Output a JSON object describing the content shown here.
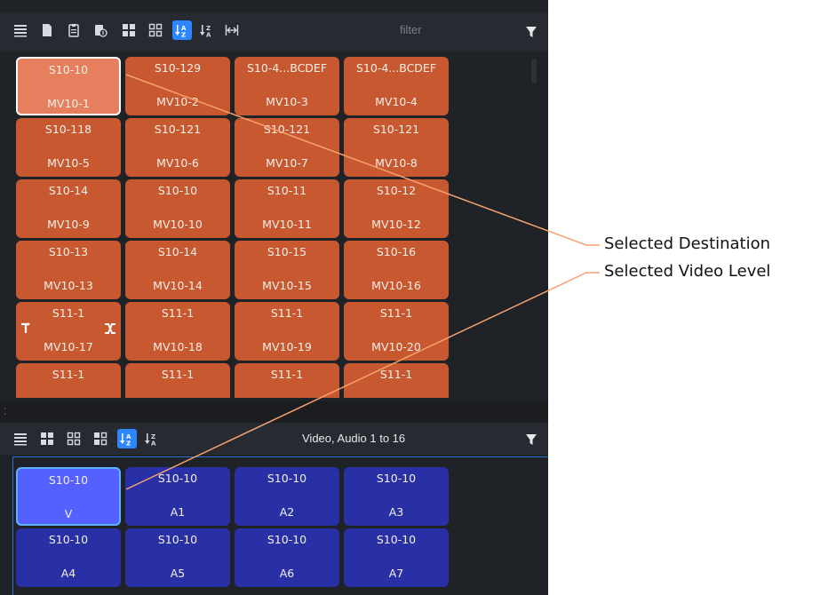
{
  "top_panel": {
    "toolbar": {
      "buttons": [
        {
          "name": "list-view-icon",
          "active": false
        },
        {
          "name": "document-icon",
          "active": false
        },
        {
          "name": "clipboard-icon",
          "active": false
        },
        {
          "name": "clipboard-info-icon",
          "active": false
        },
        {
          "name": "large-tiles-icon",
          "active": false
        },
        {
          "name": "small-tiles-icon",
          "active": false
        },
        {
          "name": "sort-a-z-icon",
          "active": true
        },
        {
          "name": "sort-z-a-icon",
          "active": false
        },
        {
          "name": "fit-width-icon",
          "active": false
        }
      ],
      "filter_placeholder": "filter",
      "filter_icon": "funnel-icon"
    },
    "destinations": [
      {
        "source": "S10-10",
        "name": "MV10-1",
        "selected": true
      },
      {
        "source": "S10-129",
        "name": "MV10-2"
      },
      {
        "source": "S10-4...BCDEF",
        "name": "MV10-3"
      },
      {
        "source": "S10-4...BCDEF",
        "name": "MV10-4"
      },
      {
        "source": "S10-118",
        "name": "MV10-5"
      },
      {
        "source": "S10-121",
        "name": "MV10-6"
      },
      {
        "source": "S10-121",
        "name": "MV10-7"
      },
      {
        "source": "S10-121",
        "name": "MV10-8"
      },
      {
        "source": "S10-14",
        "name": "MV10-9"
      },
      {
        "source": "S10-10",
        "name": "MV10-10"
      },
      {
        "source": "S10-11",
        "name": "MV10-11"
      },
      {
        "source": "S10-12",
        "name": "MV10-12"
      },
      {
        "source": "S10-13",
        "name": "MV10-13"
      },
      {
        "source": "S10-14",
        "name": "MV10-14"
      },
      {
        "source": "S10-15",
        "name": "MV10-15"
      },
      {
        "source": "S10-16",
        "name": "MV10-16"
      },
      {
        "source": "S11-1",
        "name": "MV10-17",
        "tie_icons": true
      },
      {
        "source": "S11-1",
        "name": "MV10-18"
      },
      {
        "source": "S11-1",
        "name": "MV10-19"
      },
      {
        "source": "S11-1",
        "name": "MV10-20"
      },
      {
        "source": "S11-1",
        "name": ""
      },
      {
        "source": "S11-1",
        "name": ""
      },
      {
        "source": "S11-1",
        "name": ""
      },
      {
        "source": "S11-1",
        "name": ""
      }
    ]
  },
  "bottom_panel": {
    "toolbar": {
      "buttons": [
        {
          "name": "list-view-icon",
          "active": false
        },
        {
          "name": "large-tiles-icon",
          "active": false
        },
        {
          "name": "small-tiles-icon",
          "active": false
        },
        {
          "name": "medium-tiles-icon",
          "active": false
        },
        {
          "name": "sort-a-z-icon",
          "active": true
        },
        {
          "name": "sort-z-a-icon",
          "active": false
        }
      ],
      "levels_label": "Video, Audio 1 to 16",
      "filter_icon": "funnel-icon"
    },
    "levels": [
      {
        "source": "S10-10",
        "level": "V",
        "selected": true
      },
      {
        "source": "S10-10",
        "level": "A1"
      },
      {
        "source": "S10-10",
        "level": "A2"
      },
      {
        "source": "S10-10",
        "level": "A3"
      },
      {
        "source": "S10-10",
        "level": "A4"
      },
      {
        "source": "S10-10",
        "level": "A5"
      },
      {
        "source": "S10-10",
        "level": "A6"
      },
      {
        "source": "S10-10",
        "level": "A7"
      }
    ]
  },
  "callouts": {
    "selected_destination": "Selected Destination",
    "selected_video_level": "Selected Video Level"
  },
  "colors": {
    "destination_tile": "#c8582f",
    "destination_selected": "#e57f5d",
    "level_tile": "#2930a6",
    "level_selected": "#5561ff",
    "callout_line": "#f4a26f",
    "toolbar_active": "#2e86ff"
  }
}
